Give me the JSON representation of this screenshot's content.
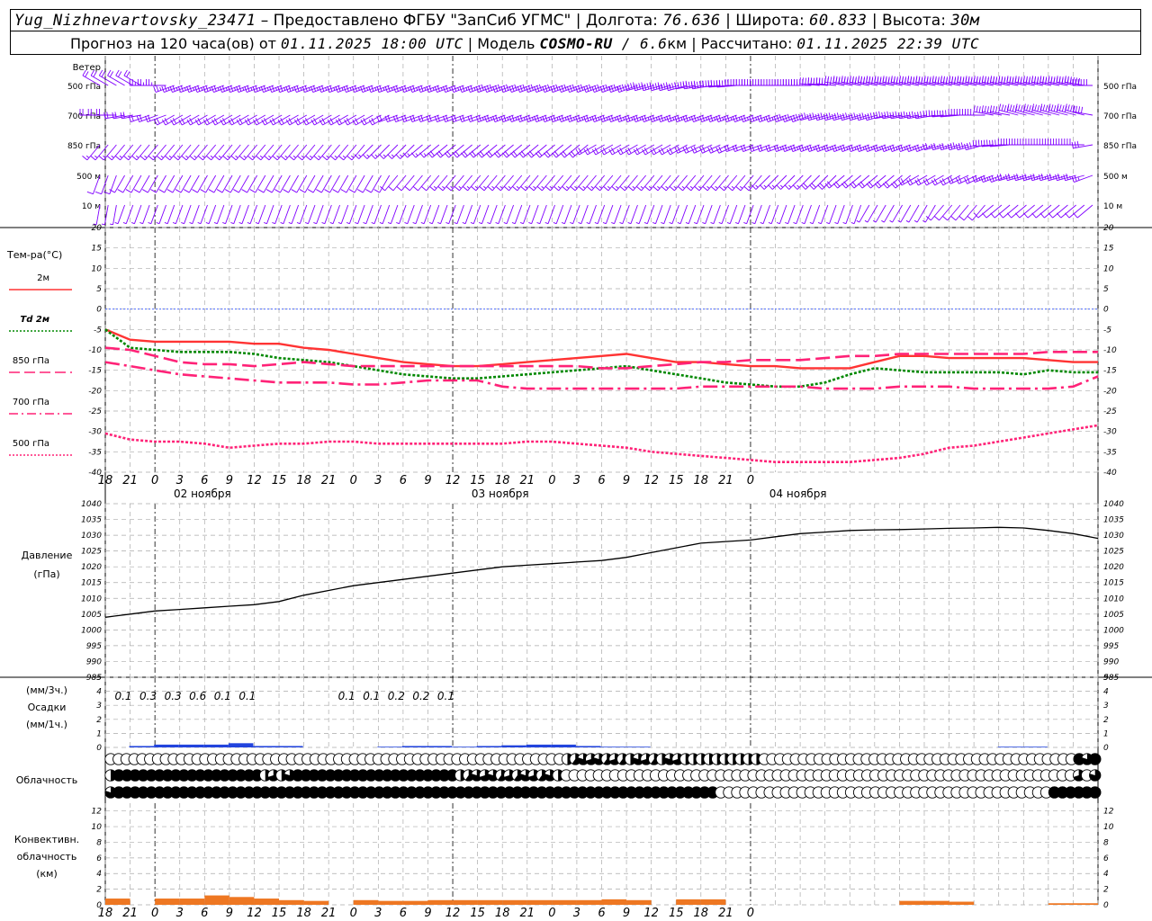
{
  "header": {
    "station": "Yug_Nizhnevartovsky_23471",
    "provider": " – Предоставлено ФГБУ \"ЗапСиб УГМС\" | Долгота: ",
    "lon": "76.636",
    "lat_label": " | Широта: ",
    "lat": "60.833",
    "alt_label": " | Высота: ",
    "alt": "30м",
    "forecast_label": "Прогноз на 120 часа(ов) от ",
    "forecast_from": "01.11.2025 18:00 UTC",
    "model_label": " | Модель ",
    "model": "COSMO-RU",
    "model_res": " / 6.6",
    "model_res_unit": "км",
    "computed_label": " | Рассчитано: ",
    "computed": "01.11.2025 22:39 UTC"
  },
  "wind_panel": {
    "title": "Ветер",
    "levels": [
      "500 гПа",
      "700 гПа",
      "850 гПа",
      "500 м",
      "10  м"
    ],
    "barb_color": "#8000ff"
  },
  "temp_panel": {
    "title": "Тем-ра(°C)",
    "legend": [
      {
        "label": "2м",
        "color": "#ff3333",
        "style": "solid"
      },
      {
        "label": "Td  2м",
        "color": "#008800",
        "style": "dotted"
      },
      {
        "label": "850 гПа",
        "color": "#ff2277",
        "style": "dash"
      },
      {
        "label": "700 гПа",
        "color": "#ff2277",
        "style": "dashdot"
      },
      {
        "label": "500 гПа",
        "color": "#ff2277",
        "style": "dot"
      }
    ]
  },
  "pressure_panel": {
    "title": "Давление",
    "unit": "(гПа)"
  },
  "precip_panel": {
    "unit_top": "(мм/3ч.)",
    "title": "Осадки",
    "unit_bottom": "(мм/1ч.)",
    "labels": [
      "0.1",
      "0.3",
      "0.3",
      "0.6",
      "0.1",
      "0.1",
      "",
      "",
      "",
      "0.1",
      "0.1",
      "0.2",
      "0.2",
      "0.1"
    ]
  },
  "cloud_panel": {
    "title": "Облачность"
  },
  "conv_panel": {
    "title_lines": [
      "Конвективн.",
      "облачность",
      "(км)"
    ]
  },
  "x_tick_labels": [
    "18",
    "21",
    "0",
    "3",
    "6",
    "9",
    "12",
    "15",
    "18",
    "21",
    "0",
    "3",
    "6",
    "9",
    "12",
    "15",
    "18",
    "21",
    "0",
    "3",
    "6",
    "9",
    "12",
    "15",
    "18",
    "21",
    "0"
  ],
  "day_labels": [
    "02 ноября",
    "03 ноября",
    "04 ноября"
  ],
  "chart_data": {
    "type": "line",
    "x_hours": [
      0,
      3,
      6,
      9,
      12,
      15,
      18,
      21,
      24,
      27,
      30,
      33,
      36,
      39,
      42,
      45,
      48,
      51,
      54,
      57,
      60,
      63,
      66,
      69,
      72,
      75,
      78,
      81,
      84,
      87,
      90,
      93,
      96,
      99,
      102,
      105,
      108,
      111,
      114,
      117,
      120
    ],
    "temperature": {
      "ylim": [
        -40,
        20
      ],
      "series": [
        {
          "name": "2м",
          "values": [
            -5,
            -7.5,
            -8,
            -8,
            -8,
            -8,
            -8.5,
            -8.5,
            -9.5,
            -10,
            -11,
            -12,
            -13,
            -13.5,
            -14,
            -14,
            -13.5,
            -13,
            -12.5,
            -12,
            -11.5,
            -11,
            -12,
            -13,
            -13,
            -13.5,
            -14,
            -14,
            -14.5,
            -14.5,
            -14.5,
            -13,
            -11.5,
            -11.5,
            -12,
            -12,
            -12,
            -12,
            -12.5,
            -13,
            -13
          ]
        },
        {
          "name": "Td  2м",
          "values": [
            -5,
            -9.5,
            -10,
            -10.5,
            -10.5,
            -10.5,
            -11,
            -12,
            -12.5,
            -13,
            -14,
            -15,
            -16,
            -16.5,
            -17,
            -17,
            -16.5,
            -16,
            -15.5,
            -15,
            -14.5,
            -14,
            -15,
            -16,
            -17,
            -18,
            -18.5,
            -19,
            -19,
            -18,
            -16,
            -14.5,
            -15,
            -15.5,
            -15.5,
            -15.5,
            -15.5,
            -16,
            -15,
            -15.5,
            -15.5
          ]
        },
        {
          "name": "850 гПа",
          "values": [
            -9.5,
            -10,
            -11.5,
            -13,
            -13.5,
            -13.5,
            -14,
            -13.5,
            -13,
            -13.5,
            -14,
            -14,
            -14,
            -14,
            -14,
            -14,
            -14,
            -14,
            -14,
            -14,
            -14.5,
            -14.5,
            -14,
            -13.5,
            -13,
            -13,
            -12.5,
            -12.5,
            -12.5,
            -12,
            -11.5,
            -11.5,
            -11,
            -11,
            -11,
            -11,
            -11,
            -11,
            -10.5,
            -10.5,
            -10.5
          ]
        },
        {
          "name": "700 гПа",
          "values": [
            -13,
            -14,
            -15,
            -16,
            -16.5,
            -17,
            -17.5,
            -18,
            -18,
            -18,
            -18.5,
            -18.5,
            -18,
            -17.5,
            -17.5,
            -17.5,
            -19,
            -19.5,
            -19.5,
            -19.5,
            -19.5,
            -19.5,
            -19.5,
            -19.5,
            -19,
            -19,
            -19,
            -19,
            -19,
            -19.5,
            -19.5,
            -19.5,
            -19,
            -19,
            -19,
            -19.5,
            -19.5,
            -19.5,
            -19.5,
            -19,
            -16.5
          ]
        },
        {
          "name": "500 гПа",
          "values": [
            -30.5,
            -32,
            -32.5,
            -32.5,
            -33,
            -34,
            -33.5,
            -33,
            -33,
            -32.5,
            -32.5,
            -33,
            -33,
            -33,
            -33,
            -33,
            -33,
            -32.5,
            -32.5,
            -33,
            -33.5,
            -34,
            -35,
            -35.5,
            -36,
            -36.5,
            -37,
            -37.5,
            -37.5,
            -37.5,
            -37.5,
            -37,
            -36.5,
            -35.5,
            -34,
            -33.5,
            -32.5,
            -31.5,
            -30.5,
            -29.5,
            -28.5
          ]
        }
      ]
    },
    "pressure": {
      "ylim": [
        985,
        1040
      ],
      "series": [
        {
          "name": "Давление",
          "values": [
            1004,
            1005,
            1006,
            1006.5,
            1007,
            1007.5,
            1008,
            1009,
            1011,
            1012.5,
            1014,
            1015,
            1016,
            1017,
            1018,
            1019,
            1020,
            1020.5,
            1021,
            1021.5,
            1022,
            1023,
            1024.5,
            1026,
            1027.5,
            1028,
            1028.5,
            1029.5,
            1030.5,
            1031,
            1031.5,
            1031.7,
            1031.8,
            1032,
            1032.2,
            1032.3,
            1032.5,
            1032.3,
            1031.5,
            1030.5,
            1029
          ]
        }
      ]
    },
    "precip_1h": {
      "ylim": [
        0,
        5
      ],
      "values": [
        0,
        0.1,
        0.2,
        0.2,
        0.2,
        0.3,
        0.1,
        0.1,
        0,
        0,
        0,
        0.05,
        0.1,
        0.1,
        0.05,
        0.1,
        0.15,
        0.2,
        0.2,
        0.1,
        0.05,
        0.05,
        0,
        0,
        0,
        0,
        0,
        0,
        0,
        0,
        0,
        0,
        0,
        0,
        0,
        0,
        0.05,
        0.05,
        0,
        0,
        0
      ]
    },
    "convective_cloud_km": {
      "ylim": [
        0,
        12
      ],
      "values": [
        0.8,
        0,
        0.8,
        0.8,
        1.2,
        1,
        0.8,
        0.6,
        0.5,
        0,
        0.6,
        0.5,
        0.5,
        0.6,
        0.6,
        0.6,
        0.6,
        0.6,
        0.6,
        0.6,
        0.7,
        0.6,
        0,
        0.7,
        0.7,
        0,
        0,
        0,
        0,
        0,
        0,
        0,
        0.5,
        0.5,
        0.4,
        0,
        0,
        0,
        0.2,
        0.2,
        0
      ]
    },
    "cloud_cover_tenths": {
      "upper": [
        0,
        0,
        0,
        0,
        0,
        0,
        0,
        0,
        0,
        0,
        0,
        0,
        0,
        0,
        0,
        0,
        0,
        0,
        0,
        0,
        0,
        0,
        0,
        0,
        0,
        0,
        0,
        0,
        0,
        0,
        0,
        0,
        0,
        0,
        0,
        0,
        0,
        0,
        0,
        0,
        0,
        0,
        0,
        0,
        0,
        0,
        0,
        0,
        0,
        0,
        0,
        0,
        0,
        0,
        0,
        0,
        0,
        0,
        5,
        6,
        8,
        7,
        8,
        6,
        7,
        6,
        5,
        8,
        7,
        6,
        5,
        8,
        7,
        5,
        5,
        5,
        5,
        5,
        5,
        5,
        5,
        5,
        5,
        0,
        0,
        0,
        0,
        0,
        0,
        0,
        0,
        0,
        0,
        0,
        0,
        0,
        0,
        0,
        0,
        0,
        0,
        0,
        0,
        0,
        0,
        0,
        0,
        0,
        0,
        0,
        0,
        0,
        0,
        0,
        0,
        0,
        0,
        0,
        0,
        0,
        0,
        0,
        0,
        10,
        8,
        10
      ],
      "middle": [
        5,
        10,
        10,
        10,
        10,
        10,
        10,
        10,
        10,
        10,
        10,
        10,
        10,
        10,
        10,
        10,
        10,
        10,
        10,
        5,
        7,
        5,
        8,
        10,
        10,
        10,
        10,
        10,
        10,
        10,
        10,
        10,
        10,
        10,
        10,
        10,
        10,
        10,
        10,
        10,
        10,
        10,
        10,
        5,
        6,
        8,
        7,
        8,
        6,
        7,
        6,
        8,
        7,
        6,
        8,
        5,
        0,
        0,
        0,
        0,
        0,
        0,
        0,
        0,
        0,
        0,
        0,
        0,
        0,
        0,
        0,
        0,
        0,
        0,
        0,
        0,
        0,
        0,
        0,
        0,
        0,
        0,
        0,
        0,
        0,
        0,
        0,
        0,
        0,
        0,
        0,
        0,
        0,
        0,
        0,
        0,
        0,
        0,
        0,
        0,
        0,
        0,
        0,
        0,
        0,
        0,
        0,
        0,
        0,
        0,
        0,
        0,
        0,
        0,
        0,
        0,
        0,
        0,
        0,
        7,
        0,
        8
      ],
      "lower": [
        8,
        10,
        10,
        10,
        10,
        10,
        10,
        10,
        10,
        10,
        10,
        10,
        10,
        10,
        10,
        10,
        10,
        10,
        10,
        10,
        10,
        10,
        10,
        10,
        10,
        10,
        10,
        10,
        10,
        10,
        10,
        10,
        10,
        10,
        10,
        10,
        10,
        10,
        10,
        10,
        10,
        10,
        10,
        10,
        10,
        10,
        10,
        10,
        10,
        10,
        10,
        10,
        10,
        10,
        10,
        10,
        10,
        10,
        10,
        10,
        10,
        10,
        10,
        10,
        10,
        10,
        10,
        10,
        10,
        10,
        10,
        10,
        10,
        10,
        10,
        0,
        0,
        0,
        0,
        0,
        0,
        0,
        0,
        0,
        0,
        0,
        0,
        0,
        0,
        0,
        0,
        0,
        0,
        0,
        0,
        0,
        0,
        0,
        0,
        0,
        0,
        0,
        0,
        0,
        0,
        0,
        0,
        0,
        0,
        0,
        0,
        0,
        0,
        0,
        0,
        0,
        10,
        10,
        10,
        10,
        10,
        10
      ]
    },
    "wind_barbs_kt": {
      "500 гПа": {
        "dir": [
          300,
          300,
          270,
          250,
          250,
          250,
          250,
          250,
          250,
          250,
          250,
          250,
          250,
          250,
          250,
          250,
          250,
          250,
          250,
          250,
          250,
          250,
          255,
          255,
          260,
          265,
          270,
          270,
          270,
          275,
          280,
          280,
          280,
          280,
          280,
          280,
          280,
          280,
          280,
          280,
          270
        ],
        "speed": [
          20,
          20,
          25,
          25,
          25,
          25,
          25,
          25,
          25,
          25,
          25,
          25,
          25,
          25,
          25,
          25,
          30,
          30,
          30,
          30,
          30,
          35,
          40,
          45,
          50,
          50,
          50,
          50,
          55,
          55,
          60,
          60,
          60,
          60,
          60,
          60,
          60,
          60,
          60,
          60,
          60
        ]
      },
      "700 гПа": {
        "dir": [
          270,
          260,
          250,
          240,
          240,
          240,
          240,
          240,
          240,
          240,
          240,
          240,
          250,
          250,
          250,
          250,
          250,
          250,
          250,
          250,
          250,
          250,
          250,
          250,
          250,
          250,
          250,
          250,
          250,
          255,
          255,
          255,
          260,
          260,
          265,
          270,
          280,
          285,
          285,
          285,
          280
        ],
        "speed": [
          20,
          20,
          20,
          20,
          20,
          20,
          20,
          20,
          20,
          20,
          20,
          20,
          20,
          20,
          20,
          20,
          25,
          25,
          25,
          25,
          25,
          25,
          25,
          25,
          25,
          25,
          25,
          25,
          30,
          30,
          30,
          30,
          30,
          30,
          30,
          35,
          35,
          40,
          40,
          40,
          40
        ]
      },
      "850 гПа": {
        "dir": [
          220,
          220,
          220,
          220,
          220,
          220,
          220,
          220,
          220,
          220,
          220,
          225,
          225,
          230,
          230,
          230,
          230,
          230,
          230,
          230,
          240,
          240,
          240,
          240,
          245,
          245,
          250,
          250,
          250,
          250,
          250,
          250,
          250,
          250,
          255,
          255,
          265,
          270,
          270,
          270,
          260
        ],
        "speed": [
          15,
          15,
          15,
          15,
          15,
          15,
          15,
          15,
          15,
          15,
          15,
          15,
          15,
          15,
          20,
          20,
          20,
          20,
          20,
          20,
          20,
          20,
          20,
          20,
          20,
          20,
          20,
          20,
          25,
          25,
          25,
          25,
          25,
          25,
          25,
          30,
          30,
          30,
          30,
          30,
          30
        ]
      },
      "500 м": {
        "dir": [
          200,
          210,
          210,
          210,
          210,
          210,
          210,
          210,
          210,
          210,
          210,
          210,
          220,
          220,
          220,
          220,
          220,
          220,
          220,
          220,
          220,
          220,
          220,
          220,
          220,
          220,
          220,
          225,
          225,
          225,
          230,
          230,
          230,
          240,
          240,
          245,
          250,
          255,
          255,
          255,
          250
        ],
        "speed": [
          10,
          10,
          10,
          10,
          10,
          10,
          10,
          10,
          10,
          10,
          10,
          10,
          10,
          10,
          15,
          15,
          15,
          15,
          15,
          15,
          15,
          15,
          15,
          15,
          15,
          15,
          15,
          15,
          15,
          20,
          20,
          20,
          20,
          20,
          20,
          20,
          25,
          25,
          25,
          25,
          25
        ]
      },
      "10  м": {
        "dir": [
          190,
          200,
          200,
          200,
          200,
          200,
          200,
          200,
          200,
          200,
          200,
          200,
          200,
          200,
          200,
          200,
          200,
          200,
          200,
          200,
          200,
          200,
          200,
          200,
          200,
          200,
          200,
          200,
          200,
          200,
          200,
          210,
          210,
          210,
          220,
          220,
          230,
          230,
          230,
          230,
          230
        ],
        "speed": [
          5,
          5,
          5,
          5,
          5,
          5,
          5,
          5,
          5,
          5,
          5,
          5,
          5,
          5,
          5,
          5,
          5,
          5,
          5,
          5,
          5,
          5,
          5,
          5,
          5,
          5,
          5,
          5,
          5,
          5,
          5,
          5,
          5,
          5,
          10,
          10,
          10,
          10,
          10,
          10,
          10
        ]
      }
    }
  }
}
